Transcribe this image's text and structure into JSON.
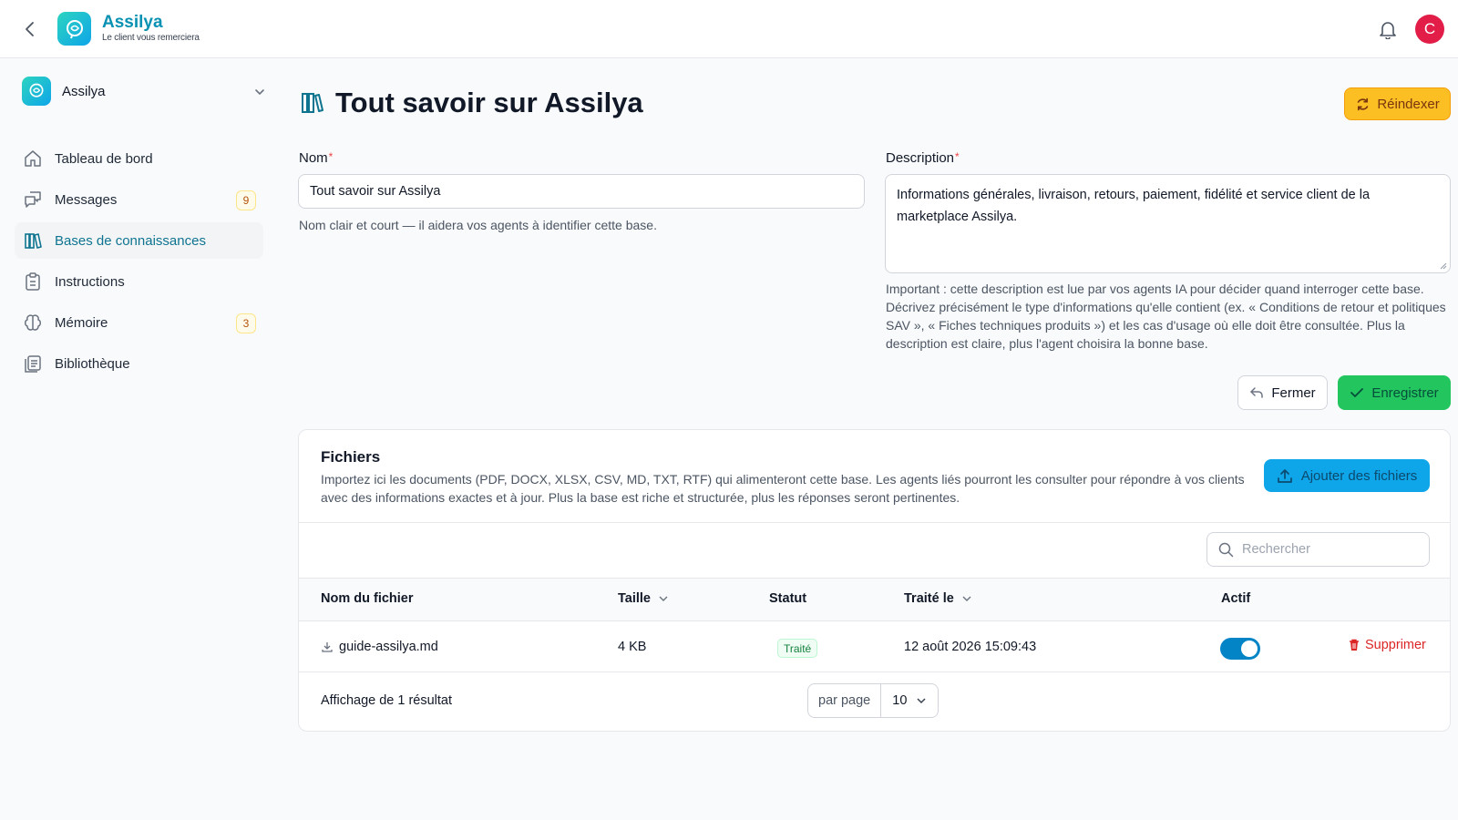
{
  "app": {
    "name": "Assilya",
    "tagline": "Le client vous remerciera",
    "user_initial": "C",
    "icons": {
      "back": "chevron-left-icon",
      "notifications": "bell-icon"
    }
  },
  "workspace": {
    "name": "Assilya"
  },
  "sidebar": {
    "items": [
      {
        "label": "Tableau de bord",
        "icon": "home-icon",
        "badge": null,
        "active": false
      },
      {
        "label": "Messages",
        "icon": "messages-icon",
        "badge": "9",
        "active": false
      },
      {
        "label": "Bases de connaissances",
        "icon": "books-icon",
        "badge": null,
        "active": true
      },
      {
        "label": "Instructions",
        "icon": "clipboard-icon",
        "badge": null,
        "active": false
      },
      {
        "label": "Mémoire",
        "icon": "brain-icon",
        "badge": "3",
        "active": false
      },
      {
        "label": "Bibliothèque",
        "icon": "library-icon",
        "badge": null,
        "active": false
      }
    ]
  },
  "page": {
    "title": "Tout savoir sur Assilya",
    "reindex_label": "Réindexer"
  },
  "form": {
    "name_label": "Nom",
    "name_value": "Tout savoir sur Assilya",
    "name_help": "Nom clair et court — il aidera vos agents à identifier cette base.",
    "description_label": "Description",
    "description_value": "Informations générales, livraison, retours, paiement, fidélité et service client de la marketplace Assilya.",
    "description_help": "Important : cette description est lue par vos agents IA pour décider quand interroger cette base. Décrivez précisément le type d'informations qu'elle contient (ex. « Conditions de retour et politiques SAV », « Fiches techniques produits ») et les cas d'usage où elle doit être consultée. Plus la description est claire, plus l'agent choisira la bonne base.",
    "close_label": "Fermer",
    "save_label": "Enregistrer"
  },
  "files": {
    "title": "Fichiers",
    "description": "Importez ici les documents (PDF, DOCX, XLSX, CSV, MD, TXT, RTF) qui alimenteront cette base. Les agents liés pourront les consulter pour répondre à vos clients avec des informations exactes et à jour. Plus la base est riche et structurée, plus les réponses seront pertinentes.",
    "add_label": "Ajouter des fichiers",
    "search_placeholder": "Rechercher",
    "columns": {
      "name": "Nom du fichier",
      "size": "Taille",
      "status": "Statut",
      "processed": "Traité le",
      "active": "Actif"
    },
    "rows": [
      {
        "name": "guide-assilya.md",
        "size": "4 KB",
        "status": "Traité",
        "processed": "12 août 2026 15:09:43",
        "active": true,
        "delete_label": "Supprimer"
      }
    ],
    "footer": "Affichage de 1 résultat",
    "per_page_label": "par page",
    "per_page_value": "10"
  },
  "colors": {
    "brand": "#0891b2",
    "reindex": "#fbbf24",
    "save": "#22c55e",
    "add_files": "#0ea5e9",
    "delete": "#dc2626"
  }
}
